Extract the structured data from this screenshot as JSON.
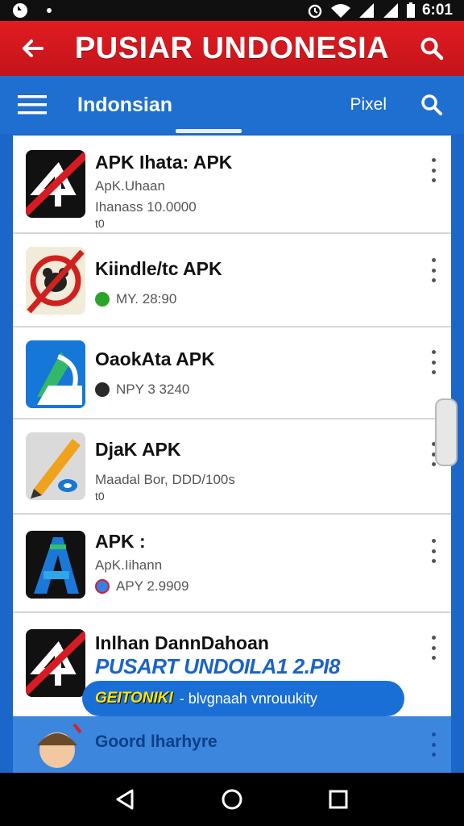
{
  "status_bar": {
    "time": "6:01"
  },
  "app_bar": {
    "title": "PUSIAR UNDONESIA"
  },
  "toolbar": {
    "label": "Indonsian",
    "pixel": "Pixel"
  },
  "apps": [
    {
      "title": "APK Ihata: APK",
      "line1": "ApK.Uhaan",
      "line2": "Ihanass 10.0000",
      "line3": "t0"
    },
    {
      "title": "Kiindle/tc APK",
      "line1": "MY. 28:90"
    },
    {
      "title": "OaokAta APK",
      "line1": "NPY 3 3240"
    },
    {
      "title": "DjaK APK",
      "line1": "Maadal Bor, DDD/100s",
      "line2": "t0"
    },
    {
      "title": "APK :",
      "line1": "ApK.Iihann",
      "line2": "APY 2.9909"
    },
    {
      "title": "Inlhan DannDahoan"
    }
  ],
  "promo": {
    "heading": "PUSART UNDOILA1 2.PI8",
    "badge": "GEITONIKI",
    "text": "- blvgnaah vnrouukity"
  },
  "faded_row": {
    "title": "Goord lharhyre"
  },
  "icons": {
    "app1": "broken-badge-icon",
    "app2": "no-bear-icon",
    "app3": "blue-arrow-icon",
    "app4": "pencil-icon",
    "app5": "blue-a-icon",
    "app6": "broken-badge-icon",
    "app7": "avatar-icon"
  }
}
